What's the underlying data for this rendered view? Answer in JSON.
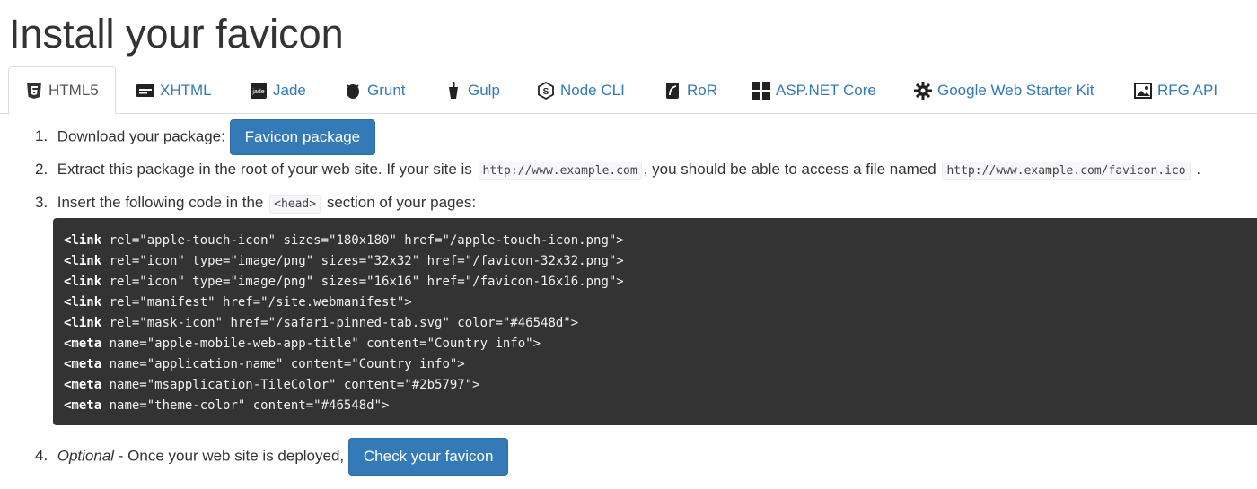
{
  "page": {
    "title": "Install your favicon"
  },
  "tabs": [
    {
      "label": "HTML5",
      "icon": "html5-icon",
      "active": true
    },
    {
      "label": "XHTML",
      "icon": "xhtml-icon"
    },
    {
      "label": "Jade",
      "icon": "jade-icon"
    },
    {
      "label": "Grunt",
      "icon": "grunt-icon"
    },
    {
      "label": "Gulp",
      "icon": "gulp-icon"
    },
    {
      "label": "Node CLI",
      "icon": "nodejs-icon"
    },
    {
      "label": "RoR",
      "icon": "rails-icon"
    },
    {
      "label": "ASP.NET Core",
      "icon": "windows-icon"
    },
    {
      "label": "Google Web Starter Kit",
      "icon": "gear-icon"
    },
    {
      "label": "RFG API",
      "icon": "image-icon"
    }
  ],
  "steps": {
    "s1": {
      "num": "1.",
      "text": "Download your package:",
      "button": "Favicon package"
    },
    "s2": {
      "num": "2.",
      "text_a": "Extract this package in the root of your web site. If your site is",
      "code_a": "http://www.example.com",
      "text_b": ", you should be able to access a file named",
      "code_b": "http://www.example.com/favicon.ico",
      "text_c": "."
    },
    "s3": {
      "num": "3.",
      "text_a": "Insert the following code in the",
      "code": "<head>",
      "text_b": "section of your pages:"
    },
    "s4": {
      "num": "4.",
      "em": "Optional",
      "text": "- Once your web site is deployed,",
      "button": "Check your favicon"
    }
  },
  "code_lines": [
    {
      "tag": "<link",
      "rest": " rel=\"apple-touch-icon\" sizes=\"180x180\" href=\"/apple-touch-icon.png\">"
    },
    {
      "tag": "<link",
      "rest": " rel=\"icon\" type=\"image/png\" sizes=\"32x32\" href=\"/favicon-32x32.png\">"
    },
    {
      "tag": "<link",
      "rest": " rel=\"icon\" type=\"image/png\" sizes=\"16x16\" href=\"/favicon-16x16.png\">"
    },
    {
      "tag": "<link",
      "rest": " rel=\"manifest\" href=\"/site.webmanifest\">"
    },
    {
      "tag": "<link",
      "rest": " rel=\"mask-icon\" href=\"/safari-pinned-tab.svg\" color=\"#46548d\">"
    },
    {
      "tag": "<meta",
      "rest": " name=\"apple-mobile-web-app-title\" content=\"Country info\">"
    },
    {
      "tag": "<meta",
      "rest": " name=\"application-name\" content=\"Country info\">"
    },
    {
      "tag": "<meta",
      "rest": " name=\"msapplication-TileColor\" content=\"#2b5797\">"
    },
    {
      "tag": "<meta",
      "rest": " name=\"theme-color\" content=\"#46548d\">"
    }
  ],
  "colors": {
    "link": "#337ab7",
    "button": "#337ab7",
    "code_bg": "#333333"
  }
}
